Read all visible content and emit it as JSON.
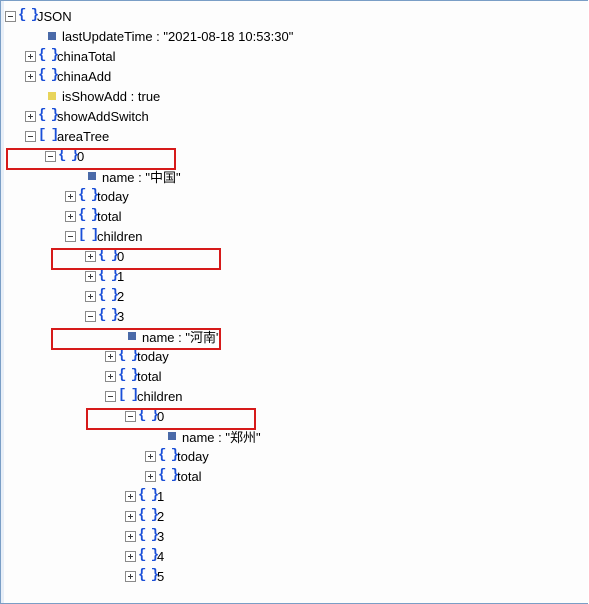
{
  "root_label": "JSON",
  "lastUpdateTime": {
    "key": "lastUpdateTime",
    "value": "\"2021-08-18 10:53:30\""
  },
  "chinaTotal": "chinaTotal",
  "chinaAdd": "chinaAdd",
  "isShowAdd": {
    "key": "isShowAdd",
    "value": "true"
  },
  "showAddSwitch": "showAddSwitch",
  "areaTree": {
    "label": "areaTree",
    "items": [
      {
        "idx": "0",
        "name": {
          "key": "name",
          "value": "\"中国\""
        },
        "today": "today",
        "total": "total",
        "children": {
          "label": "children",
          "items": [
            {
              "idx": "0"
            },
            {
              "idx": "1"
            },
            {
              "idx": "2"
            },
            {
              "idx": "3",
              "name": {
                "key": "name",
                "value": "\"河南\""
              },
              "today": "today",
              "total": "total",
              "children": {
                "label": "children",
                "items": [
                  {
                    "idx": "0",
                    "name": {
                      "key": "name",
                      "value": "\"郑州\""
                    },
                    "today": "today",
                    "total": "total"
                  },
                  {
                    "idx": "1"
                  },
                  {
                    "idx": "2"
                  },
                  {
                    "idx": "3"
                  },
                  {
                    "idx": "4"
                  },
                  {
                    "idx": "5"
                  }
                ]
              }
            }
          ]
        }
      }
    ]
  },
  "sep": " : "
}
